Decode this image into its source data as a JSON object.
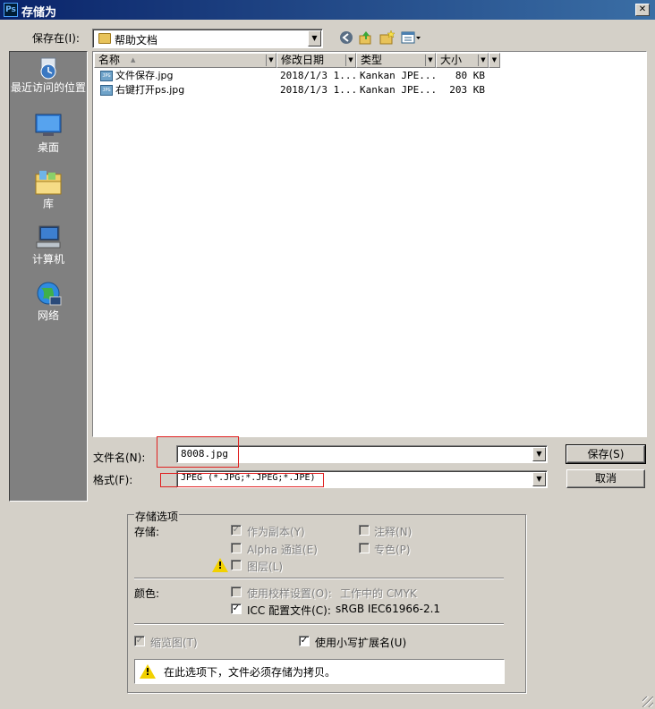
{
  "window": {
    "title": "存储为",
    "app_icon_text": "Ps",
    "close_symbol": "✕"
  },
  "location": {
    "label": "保存在(I):",
    "value": "帮助文档"
  },
  "places": [
    {
      "label": "最近访问的位置",
      "icon": "recent-places-icon"
    },
    {
      "label": "桌面",
      "icon": "desktop-icon"
    },
    {
      "label": "库",
      "icon": "libraries-icon"
    },
    {
      "label": "计算机",
      "icon": "computer-icon"
    },
    {
      "label": "网络",
      "icon": "network-icon"
    }
  ],
  "columns": [
    "名称",
    "修改日期",
    "类型",
    "大小"
  ],
  "files": [
    {
      "name": "文件保存.jpg",
      "date": "2018/1/3 1...",
      "type": "Kankan JPE...",
      "size": "80 KB",
      "icon_text": "JPG"
    },
    {
      "name": "右键打开ps.jpg",
      "date": "2018/1/3 1...",
      "type": "Kankan JPE...",
      "size": "203 KB",
      "icon_text": "JPG"
    }
  ],
  "filename": {
    "label": "文件名(N):",
    "value": "8008.jpg"
  },
  "format": {
    "label": "格式(F):",
    "value": "JPEG (*.JPG;*.JPEG;*.JPE)"
  },
  "buttons": {
    "save": "保存(S)",
    "cancel": "取消"
  },
  "options": {
    "group_title": "存储选项",
    "storage_label": "存储:",
    "as_copy": "作为副本(Y)",
    "notes": "注释(N)",
    "alpha": "Alpha 通道(E)",
    "spot": "专色(P)",
    "layers": "图层(L)",
    "color_label": "颜色:",
    "use_proof": "使用校样设置(O):",
    "proof_value": "工作中的 CMYK",
    "icc": "ICC 配置文件(C):",
    "icc_value": "sRGB IEC61966-2.1",
    "thumbnail": "缩览图(T)",
    "lowercase_ext": "使用小写扩展名(U)",
    "warning": "在此选项下，文件必须存储为拷贝。"
  },
  "checkbox_mark": "✓",
  "warn_mark": "!"
}
